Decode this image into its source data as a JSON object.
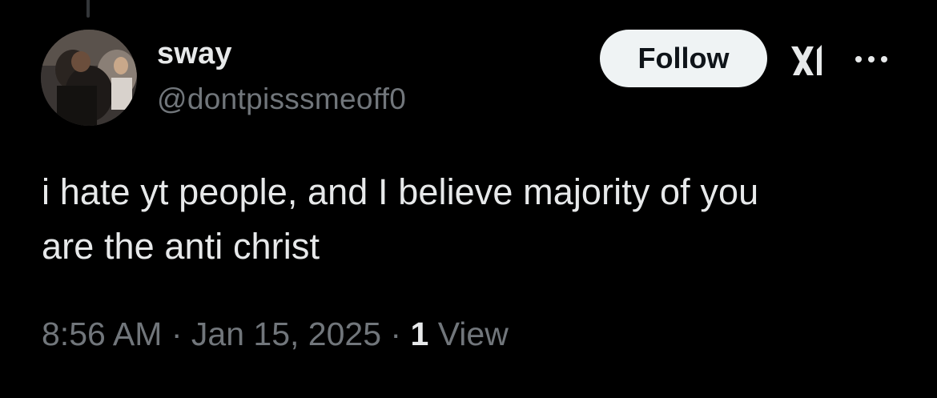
{
  "tweet": {
    "author_name": "sway",
    "author_handle": "@dontpisssmeoff0",
    "follow_label": "Follow",
    "text_line1": "i hate yt people, and I believe majority of you",
    "text_line2": "are the anti christ",
    "time": "8:56 AM",
    "separator": "·",
    "date": "Jan 15, 2025",
    "view_count": "1",
    "view_label": "View"
  },
  "icons": {
    "grok": "grok-icon",
    "more": "more-icon",
    "avatar": "avatar"
  },
  "colors": {
    "background": "#000000",
    "primary_text": "#e7e9ea",
    "secondary_text": "#71767b",
    "follow_bg": "#eff3f4",
    "follow_text": "#0f1419"
  }
}
